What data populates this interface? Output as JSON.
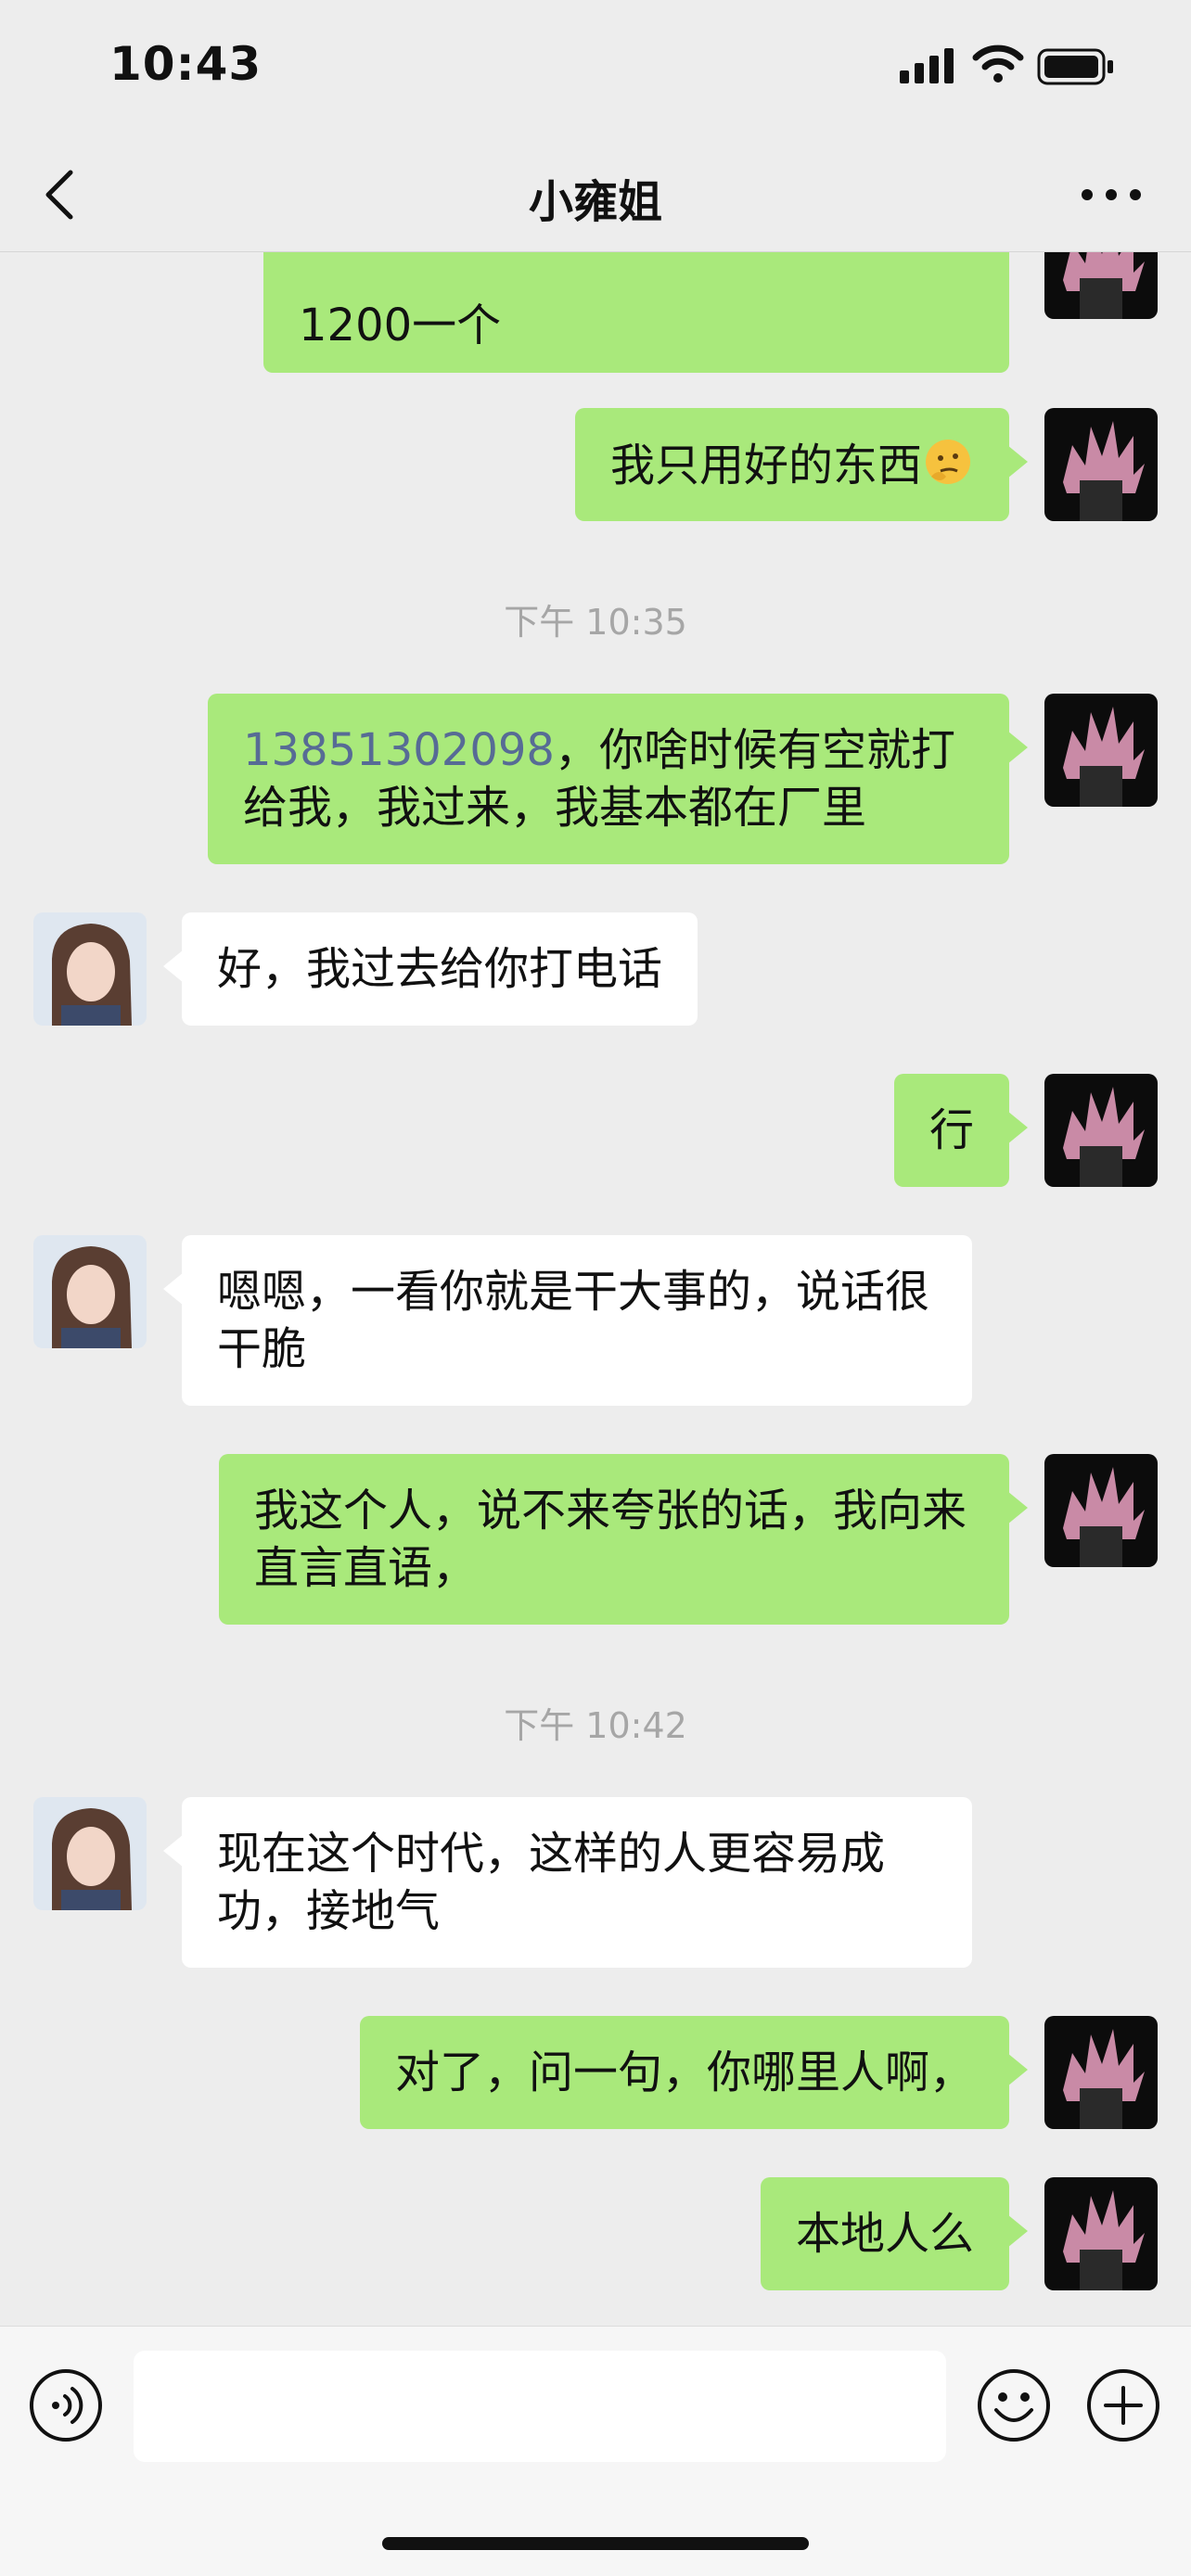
{
  "status_bar": {
    "time": "10:43"
  },
  "nav": {
    "title": "小雍姐"
  },
  "messages": [
    {
      "text": "1200一个"
    },
    {
      "text": "我只用好的东西"
    },
    {
      "text": "13851302098"
    },
    {
      "text": "，你啥时候有空就打给我，我过来，我基本都在厂里"
    },
    {
      "text": "好，我过去给你打电话"
    },
    {
      "text": "行"
    },
    {
      "text": "嗯嗯，一看你就是干大事的，说话很干脆"
    },
    {
      "text": "我这个人，说不来夸张的话，我向来直言直语，"
    },
    {
      "text": "现在这个时代，这样的人更容易成功，接地气"
    },
    {
      "text": "对了，问一句，你哪里人啊，"
    },
    {
      "text": "本地人么"
    }
  ],
  "timestamps": [
    "下午 10:35",
    "下午 10:42"
  ],
  "input": {
    "placeholder": ""
  },
  "colors": {
    "self_bubble": "#a9e97b",
    "other_bubble": "#ffffff",
    "background": "#ededed",
    "link": "#576b95"
  },
  "icons": [
    "back-icon",
    "more-icon",
    "voice-icon",
    "emoji-icon",
    "plus-icon",
    "signal-icon",
    "wifi-icon",
    "battery-icon"
  ]
}
